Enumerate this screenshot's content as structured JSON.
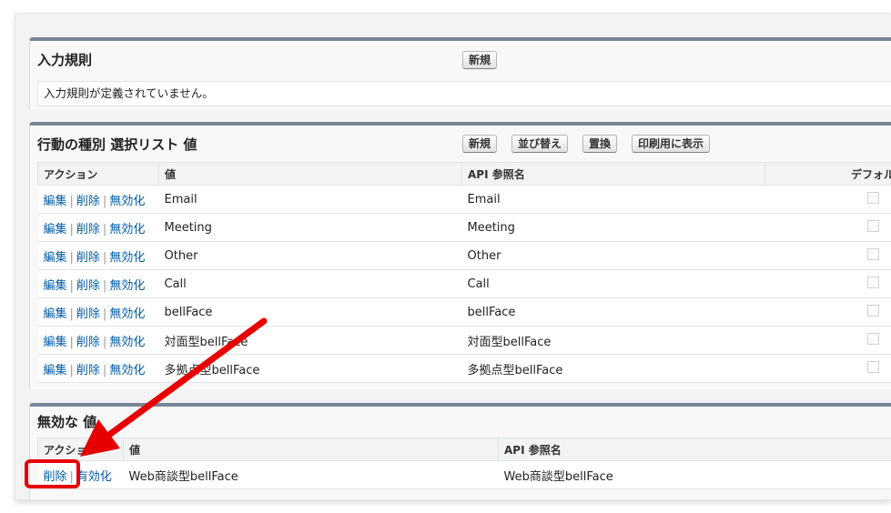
{
  "validation_rules": {
    "title": "入力規則",
    "new_button": "新規",
    "empty_message": "入力規則が定義されていません。"
  },
  "picklist": {
    "title": "行動の種別 選択リスト 値",
    "buttons": {
      "new": "新規",
      "reorder": "並び替え",
      "replace": "置換",
      "print": "印刷用に表示"
    },
    "columns": {
      "action": "アクション",
      "value": "値",
      "api_name": "API 参照名",
      "default": "デフォルト"
    },
    "action_links": {
      "edit": "編集",
      "delete": "削除",
      "deactivate": "無効化"
    },
    "rows": [
      {
        "value": "Email",
        "api_name": "Email"
      },
      {
        "value": "Meeting",
        "api_name": "Meeting"
      },
      {
        "value": "Other",
        "api_name": "Other"
      },
      {
        "value": "Call",
        "api_name": "Call"
      },
      {
        "value": "bellFace",
        "api_name": "bellFace"
      },
      {
        "value": "対面型bellFace",
        "api_name": "対面型bellFace"
      },
      {
        "value": "多拠点型bellFace",
        "api_name": "多拠点型bellFace"
      }
    ]
  },
  "inactive": {
    "title": "無効な 値",
    "columns": {
      "action": "アクション",
      "value": "値",
      "api_name": "API 参照名"
    },
    "action_links": {
      "delete": "削除",
      "activate": "有効化"
    },
    "rows": [
      {
        "value": "Web商談型bellFace",
        "api_name": "Web商談型bellFace"
      }
    ]
  },
  "annotation_color": "#e60000"
}
